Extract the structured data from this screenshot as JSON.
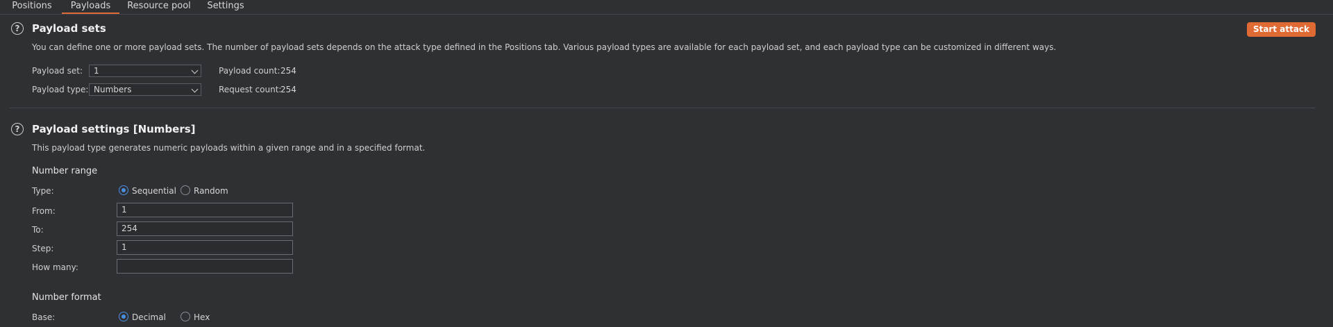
{
  "tabs": [
    {
      "label": "Positions"
    },
    {
      "label": "Payloads"
    },
    {
      "label": "Resource pool"
    },
    {
      "label": "Settings"
    }
  ],
  "payload_sets": {
    "title": "Payload sets",
    "description": "You can define one or more payload sets. The number of payload sets depends on the attack type defined in the Positions tab. Various payload types are available for each payload set, and each payload type can be customized in different ways.",
    "set_label": "Payload set:",
    "set_value": "1",
    "type_label": "Payload type:",
    "type_value": "Numbers",
    "payload_count_label": "Payload count:",
    "payload_count": "254",
    "request_count_label": "Request count:",
    "request_count": "254",
    "start_attack": "Start attack"
  },
  "payload_settings": {
    "title": "Payload settings [Numbers]",
    "description": "This payload type generates numeric payloads within a given range and in a specified format.",
    "number_range": {
      "heading": "Number range",
      "type_label": "Type:",
      "option_sequential": "Sequential",
      "option_random": "Random",
      "selected": "Sequential",
      "from_label": "From:",
      "from_value": "1",
      "to_label": "To:",
      "to_value": "254",
      "step_label": "Step:",
      "step_value": "1",
      "how_many_label": "How many:",
      "how_many_value": ""
    },
    "number_format": {
      "heading": "Number format",
      "base_label": "Base:",
      "option_decimal": "Decimal",
      "option_hex": "Hex",
      "selected": "Decimal"
    }
  },
  "colors": {
    "accent": "#e06a33",
    "radio_selected": "#4b8ee0",
    "background": "#2f3034"
  },
  "icons": {
    "help": "help-circle-icon",
    "dropdown": "chevron-down-icon"
  }
}
